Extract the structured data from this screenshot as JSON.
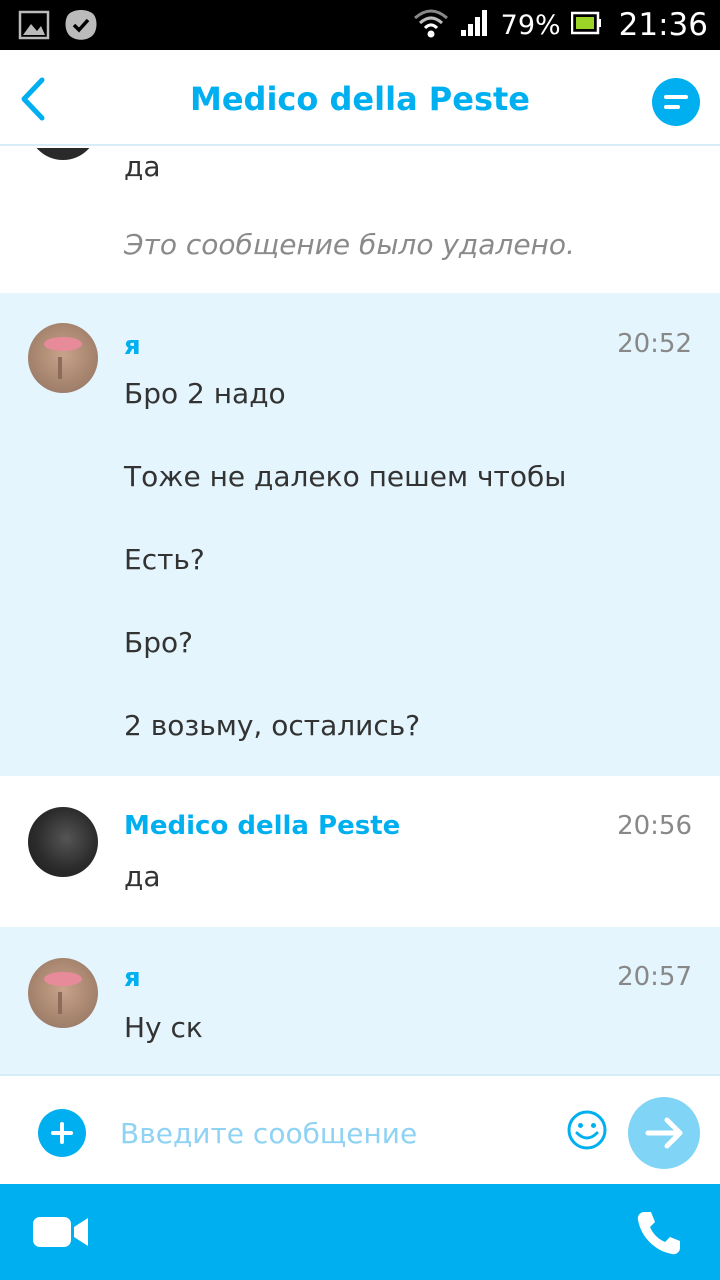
{
  "status_bar": {
    "battery_percent": "79%",
    "time": "21:36"
  },
  "header": {
    "title": "Medico della Peste"
  },
  "top_fragment": {
    "text": "да",
    "deleted_text": "Это сообщение было удалено."
  },
  "messages": [
    {
      "sender": "я",
      "time": "20:52",
      "lines": [
        "Бро 2 надо",
        "Тоже не далеко пешем чтобы",
        "Есть?",
        "Бро?",
        "2 возьму, остались?"
      ]
    },
    {
      "sender": "Medico della Peste",
      "time": "20:56",
      "lines": [
        "да"
      ]
    },
    {
      "sender": "я",
      "time": "20:57",
      "lines": [
        "Ну ск"
      ]
    }
  ],
  "composer": {
    "placeholder": "Введите сообщение"
  },
  "colors": {
    "accent": "#00aff0",
    "my_bubble_bg": "#e4f5fd"
  }
}
